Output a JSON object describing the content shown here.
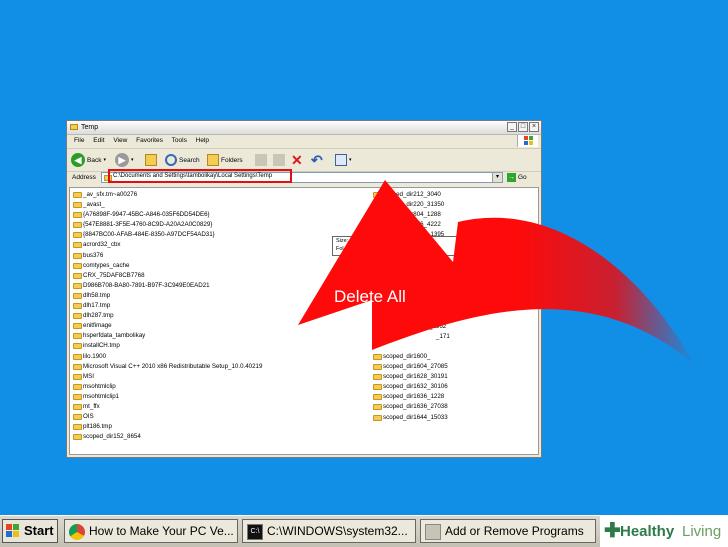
{
  "window": {
    "title": "Temp",
    "menu": [
      "File",
      "Edit",
      "View",
      "Favorites",
      "Tools",
      "Help"
    ],
    "toolbar": {
      "back": "Back",
      "search": "Search",
      "folders": "Folders"
    },
    "address": {
      "label": "Address",
      "path": "C:\\Documents and Settings\\tambolikay\\Local Settings\\Temp",
      "go": "Go"
    }
  },
  "files_left": [
    "_av_sfx.tm~a00276",
    "_avast_",
    "{A76898F-9947-45BC-A846-035F6DD54DE6}",
    "{547E8881-3F5E-4760-8C9D-A20A2A0C0829}",
    "{8847BC00-AFAB-484E-8350-A97DCF54AD31}",
    "acrord32_cbx",
    "bus376",
    "comtypes_cache",
    "CRX_75DAF8CB7768",
    "D986B708-BA80-7891-B97F-3C949E0EAD21",
    "dlh58.tmp",
    "dlh17.tmp",
    "dlh287.tmp",
    "enitfimage",
    "hsperfdata_tambolikay",
    "installCH.tmp",
    "lilo.1900",
    "Microsoft Visual C++ 2010  x86 Redistributable Setup_10.0.40219",
    "MSI",
    "msohtmlclip",
    "msohtmlclip1",
    "mt_ffx",
    "OIS",
    "plt186.tmp",
    "scoped_dir152_8654"
  ],
  "files_right_top": [
    "scoped_dir212_3040",
    "scoped_dir220_31350",
    "scoped_dir804_1288",
    "scoped_dir956_4222",
    "scoped_dir1016_1395"
  ],
  "files_right_partial": [
    "_2362",
    "_171"
  ],
  "files_right_bottom": [
    "scoped_dir1600_",
    "scoped_dir1604_27085",
    "scoped_dir1628_30191",
    "scoped_dir1632_30106",
    "scoped_dir1636_1228",
    "scoped_dir1636_27038",
    "scoped_dir1644_15033"
  ],
  "tooltip": {
    "line1": "Size:",
    "line2": "Fol"
  },
  "annotation": {
    "text": "Delete All",
    "arrow_color": "#ff0a0a"
  },
  "taskbar": {
    "start": "Start",
    "tasks": [
      "How to Make Your PC Ve...",
      "C:\\WINDOWS\\system32...",
      "Add or Remove Programs"
    ],
    "brand_first": "Healthy",
    "brand_second": "Living"
  },
  "colors": {
    "desktop": "#118ee5",
    "highlight": "#e01010"
  }
}
